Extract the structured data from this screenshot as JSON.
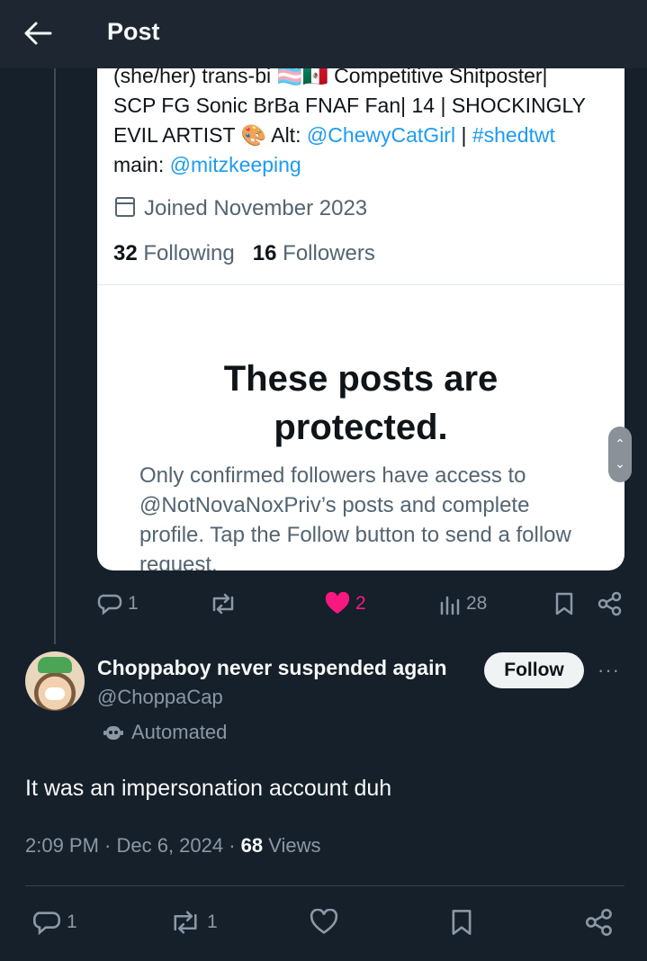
{
  "header": {
    "title": "Post"
  },
  "embedded_profile": {
    "bio_line0": "(she/her) trans-bi 🏳️‍⚧️🇲🇽 Competitive Shitposter|",
    "bio_line1": "SCP FG Sonic BrBa FNAF Fan| 14 | SHOCKINGLY",
    "bio_line2_prefix": "EVIL ARTIST 🎨 Alt: ",
    "bio_alt_handle": "@ChewyCatGirl",
    "bio_sep": " | ",
    "bio_hashtag": "#shedtwt",
    "bio_line3_prefix": "main: ",
    "bio_main_handle": "@mitzkeeping",
    "joined": "Joined November 2023",
    "following_count": "32",
    "following_label": "Following",
    "followers_count": "16",
    "followers_label": "Followers",
    "protected_title": "These posts are protected.",
    "protected_text": "Only confirmed followers have access to @NotNovaNoxPriv’s posts and complete profile. Tap the Follow button to send a follow request."
  },
  "quoted_actions": {
    "replies": "1",
    "likes": "2",
    "views": "28"
  },
  "post": {
    "author_name": "Choppaboy never suspended again",
    "author_handle": "@ChoppaCap",
    "automated_label": "Automated",
    "follow_label": "Follow",
    "more_label": "···",
    "text": "It was an impersonation account duh",
    "time": "2:09 PM · Dec 6, 2024 · ",
    "views_count": "68",
    "views_label": " Views"
  },
  "post_actions": {
    "replies": "1",
    "reposts": "1"
  },
  "colors": {
    "background": "#15202b",
    "like": "#f91880",
    "link": "#1d9bf0"
  }
}
